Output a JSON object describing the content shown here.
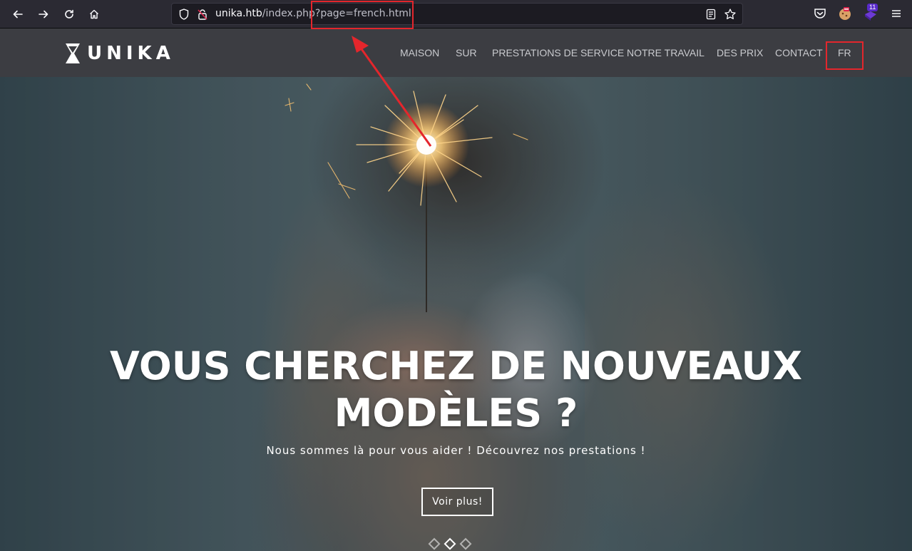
{
  "browser": {
    "url_host": "unika.htb",
    "url_path": "/index.php?page=french.html",
    "extension_badge": "11"
  },
  "site": {
    "logo_text": "UNIKA",
    "nav": [
      {
        "label": "MAISON"
      },
      {
        "label": "SUR"
      },
      {
        "label": "PRESTATIONS DE SERVICE"
      },
      {
        "label": "NOTRE TRAVAIL"
      },
      {
        "label": "DES PRIX"
      },
      {
        "label": "CONTACT"
      },
      {
        "label": "FR"
      }
    ]
  },
  "hero": {
    "headline_line1": "VOUS CHERCHEZ DE NOUVEAUX",
    "headline_line2": "MODÈLES ?",
    "subline": "Nous sommes là pour vous aider ! Découvrez nos prestations !",
    "cta_label": "Voir plus!",
    "slides": 3,
    "active_slide": 2
  },
  "colors": {
    "annotation": "#e4262c",
    "nav_bg": "#3c3d42"
  }
}
